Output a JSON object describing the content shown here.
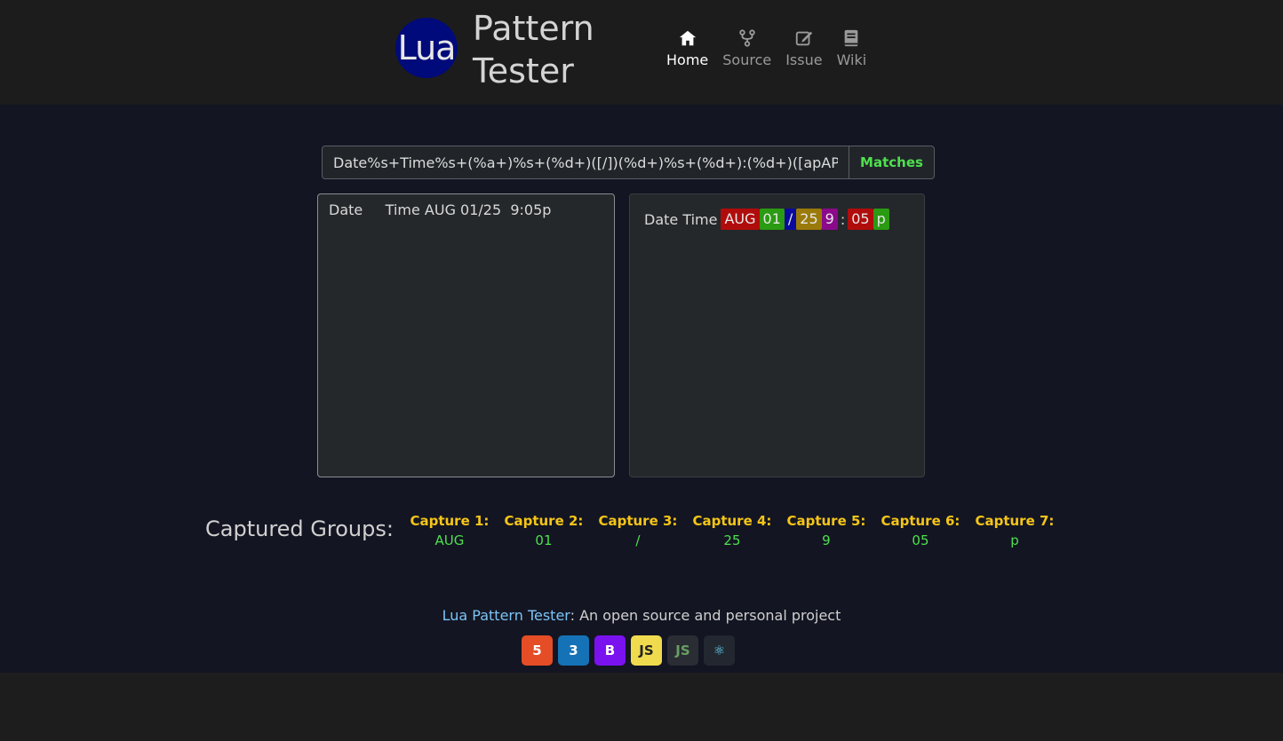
{
  "app": {
    "logo_text": "Lua",
    "title_line1": "Pattern",
    "title_line2": "Tester"
  },
  "nav": {
    "items": [
      {
        "label": "Home",
        "icon": "home-icon",
        "active": true
      },
      {
        "label": "Source",
        "icon": "fork-icon",
        "active": false
      },
      {
        "label": "Issue",
        "icon": "edit-icon",
        "active": false
      },
      {
        "label": "Wiki",
        "icon": "book-icon",
        "active": false
      }
    ]
  },
  "pattern": {
    "value": "Date%s+Time%s+(%a+)%s+(%d+)([/])(%d+)%s+(%d+):(%d+)([apAP])",
    "addon_label": "Matches"
  },
  "subject": {
    "text": "Date     Time AUG 01/25  9:05p"
  },
  "result": {
    "prefix": "Date Time",
    "chips": [
      {
        "text": "AUG",
        "color": "#b00c0c"
      },
      {
        "text": "01",
        "color": "#2a9b12"
      },
      {
        "text": "/",
        "color": "#0a0a9e"
      },
      {
        "text": "25",
        "color": "#9a7a0a"
      },
      {
        "text": "9",
        "color": "#8a0a8a"
      },
      {
        "text": ":",
        "color": null
      },
      {
        "text": "05",
        "color": "#b00c0c"
      },
      {
        "text": "p",
        "color": "#2a9b12"
      }
    ]
  },
  "captures": {
    "title": "Captured Groups:",
    "items": [
      {
        "label": "Capture 1:",
        "value": "AUG"
      },
      {
        "label": "Capture 2:",
        "value": "01"
      },
      {
        "label": "Capture 3:",
        "value": "/"
      },
      {
        "label": "Capture 4:",
        "value": "25"
      },
      {
        "label": "Capture 5:",
        "value": "9"
      },
      {
        "label": "Capture 6:",
        "value": "05"
      },
      {
        "label": "Capture 7:",
        "value": "p"
      }
    ]
  },
  "footer": {
    "link_text": "Lua Pattern Tester",
    "rest_text": ": An open source and personal project",
    "tech": [
      {
        "icon": "html5-icon",
        "glyph": "5",
        "bg": "#e44d26",
        "fg": "#ffffff"
      },
      {
        "icon": "css3-icon",
        "glyph": "3",
        "bg": "#1572b6",
        "fg": "#ffffff"
      },
      {
        "icon": "bootstrap-icon",
        "glyph": "B",
        "bg": "#7a12f0",
        "fg": "#ffffff"
      },
      {
        "icon": "javascript-icon",
        "glyph": "JS",
        "bg": "#f0db4f",
        "fg": "#222222"
      },
      {
        "icon": "nodejs-icon",
        "glyph": "JS",
        "bg": "#2a2d33",
        "fg": "#68a063"
      },
      {
        "icon": "react-icon",
        "glyph": "⚛",
        "bg": "#23272f",
        "fg": "#61dafb"
      }
    ]
  }
}
